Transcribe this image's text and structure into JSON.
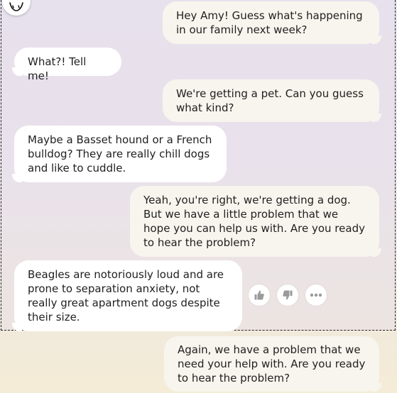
{
  "conversation": {
    "messages": [
      {
        "role": "user",
        "text": "Hey Amy!  Guess what's happening in our family next week?"
      },
      {
        "role": "assistant",
        "text": "What?! Tell me!"
      },
      {
        "role": "user",
        "text": "We're getting a pet.  Can you guess what kind?"
      },
      {
        "role": "assistant",
        "text": "Maybe a Basset hound or a French bulldog? They are really chill dogs and like to cuddle."
      },
      {
        "role": "user",
        "text": "Yeah, you're right, we're getting a dog.  But we have a little problem that we hope you can help us with.  Are you ready to hear the problem?"
      },
      {
        "role": "assistant",
        "text": "Beagles are notoriously loud and are prone to separation anxiety, not really great apartment dogs despite their size."
      },
      {
        "role": "user",
        "text": "Again, we have a problem that we need your help with.  Are you ready to hear the problem?"
      }
    ]
  },
  "message_actions": {
    "icons": [
      "thumbs-up-icon",
      "thumbs-down-icon",
      "more-options-icon"
    ]
  },
  "colors": {
    "assistant_bubble": "#ffffff",
    "user_bubble": "#f8f5ee",
    "icon_gray": "#9a9a9a",
    "text": "#1f1f1f"
  }
}
